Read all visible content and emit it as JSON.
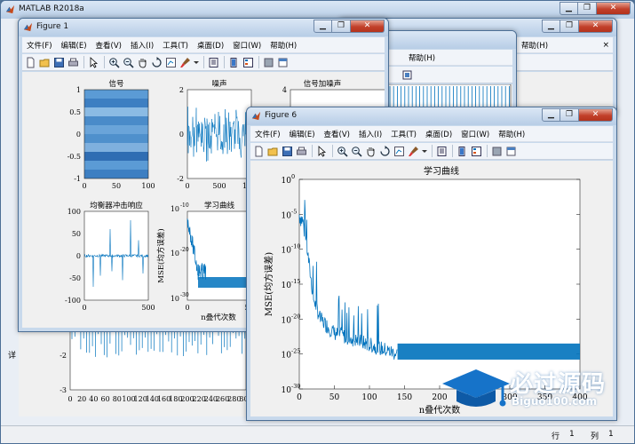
{
  "desktop": {
    "title": "MATLAB R2018a",
    "status_row_label": "行",
    "status_row_value": "1",
    "status_col_label": "列",
    "status_col_value": "1",
    "left_edge_text": "详"
  },
  "menu_labels": [
    "文件(F)",
    "编辑(E)",
    "查看(V)",
    "插入(I)",
    "工具(T)",
    "桌面(D)",
    "窗口(W)",
    "帮助(H)"
  ],
  "help_menu": "帮助(H)",
  "figure1": {
    "title": "Figure 1",
    "subplot_signal": {
      "title": "信号",
      "yticks": [
        "1",
        "0.5",
        "0",
        "-0.5",
        "-1"
      ],
      "xticks": [
        "0",
        "50",
        "100"
      ]
    },
    "subplot_noise": {
      "title": "噪声",
      "yticks": [
        "2",
        "0",
        "-2"
      ],
      "xticks": [
        "0",
        "500",
        "1000"
      ]
    },
    "subplot_signal_noise": {
      "title": "信号加噪声",
      "yticks": [
        "4"
      ]
    },
    "subplot_equalizer": {
      "title": "均衡器冲击响应",
      "yticks": [
        "100",
        "50",
        "0",
        "-50",
        "-100"
      ],
      "xticks": [
        "0",
        "500"
      ]
    },
    "subplot_learning": {
      "title": "学习曲线",
      "yticks": [
        "10",
        "-10",
        "10",
        "-20",
        "10",
        "-30"
      ],
      "xticks": [
        "0",
        "500"
      ],
      "ylabel": "MSE(均方误差)",
      "xlabel": "n叠代次数"
    }
  },
  "figure6": {
    "title": "Figure 6",
    "plot": {
      "title": "学习曲线",
      "ylabel": "MSE(均方误差)",
      "xlabel": "n叠代次数",
      "ytick_bases": [
        "10",
        "10",
        "10",
        "10",
        "10",
        "10",
        "10"
      ],
      "ytick_exps": [
        "0",
        "-5",
        "-10",
        "-15",
        "-20",
        "-25",
        "-30"
      ],
      "xticks": [
        "0",
        "50",
        "100",
        "150",
        "200",
        "250",
        "300",
        "350",
        "400"
      ]
    }
  },
  "background_plot": {
    "yticks": [
      "-2",
      "-3"
    ],
    "xticks": [
      "0",
      "20",
      "40",
      "60",
      "80",
      "100",
      "120",
      "140",
      "160",
      "180",
      "200",
      "220",
      "240",
      "260",
      "280",
      "300"
    ]
  },
  "watermark": {
    "text": "必过源码",
    "url": "Biguo100.com"
  },
  "colors": {
    "line": "#0072bd",
    "title_bar_top": "#dbe7f5",
    "close_button": "#c2402a"
  },
  "chart_data": [
    {
      "type": "line",
      "title": "学习曲线",
      "xlabel": "n叠代次数",
      "ylabel": "MSE(均方误差)",
      "yscale": "log",
      "xlim": [
        0,
        400
      ],
      "ylim": [
        1e-30,
        1
      ],
      "x": [
        0,
        5,
        10,
        20,
        30,
        50,
        80,
        110,
        140,
        200,
        300,
        400
      ],
      "series": [
        {
          "values": [
            1e-05,
            1e-06,
            1e-09,
            1e-17,
            1e-20,
            1e-22,
            1e-23,
            1e-24,
            1e-25,
            1e-25,
            1e-25,
            1e-25
          ]
        }
      ]
    }
  ]
}
